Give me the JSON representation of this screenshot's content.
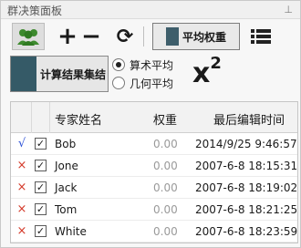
{
  "panel": {
    "title": "群决策面板",
    "pin_icon": "pin-icon"
  },
  "toolbar": {
    "group_icon": "group-icon",
    "add_label": "+",
    "remove_label": "−",
    "refresh_label": "⟳",
    "average_weight_label": "平均权重",
    "list_icon": "list-icon"
  },
  "calc": {
    "aggregate_label": "计算结果集结",
    "options": [
      {
        "label": "算术平均",
        "selected": true
      },
      {
        "label": "几何平均",
        "selected": false
      }
    ],
    "formula": "x",
    "formula_sup": "2"
  },
  "table": {
    "headers": {
      "name": "专家姓名",
      "weight": "权重",
      "time": "最后编辑时间"
    },
    "rows": [
      {
        "status": "√",
        "name": "Bob",
        "weight": "0.00",
        "time": "2014/9/25 9:46:57"
      },
      {
        "status": "×",
        "name": "Jone",
        "weight": "0.00",
        "time": "2007-6-8 18:15:31"
      },
      {
        "status": "×",
        "name": "Jack",
        "weight": "0.00",
        "time": "2007-6-8 18:19:02"
      },
      {
        "status": "×",
        "name": "Tom",
        "weight": "0.00",
        "time": "2007-6-8 18:21:25"
      },
      {
        "status": "×",
        "name": "White",
        "weight": "0.00",
        "time": "2007-6-8 18:23:59"
      }
    ]
  },
  "colors": {
    "accent": "#355a67",
    "ok": "#2a4fd6",
    "bad": "#d43a2a"
  }
}
